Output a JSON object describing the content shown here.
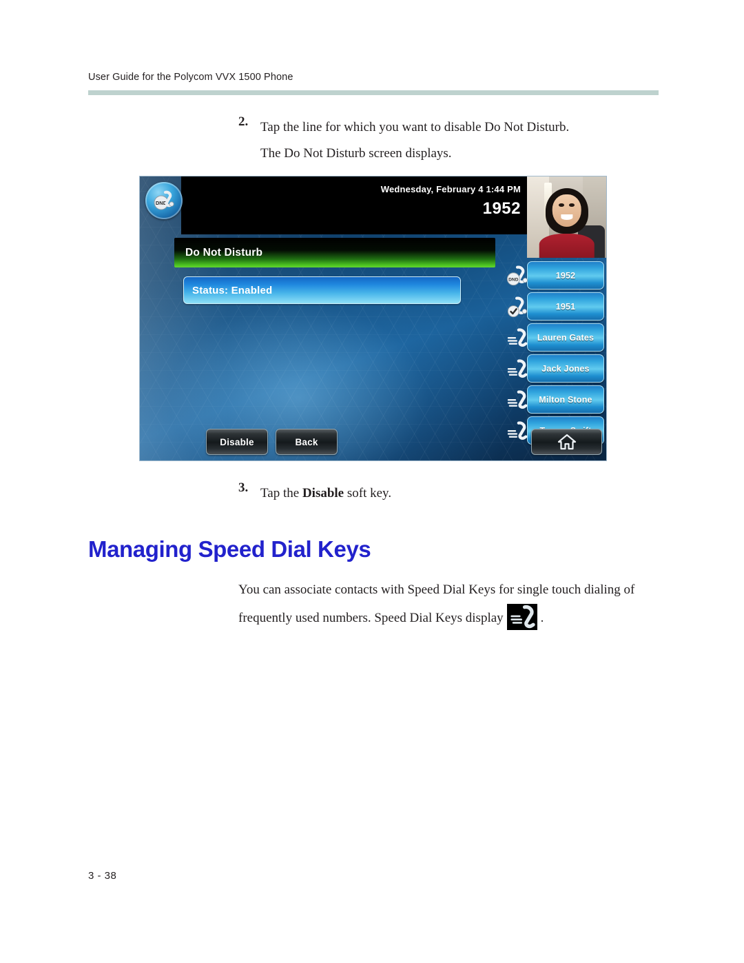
{
  "header": {
    "guide_title": "User Guide for the Polycom VVX 1500 Phone"
  },
  "steps": [
    {
      "number": "2.",
      "text": "Tap the line for which you want to disable Do Not Disturb.",
      "subtext": "The Do Not Disturb screen displays."
    },
    {
      "number": "3.",
      "text_before": "Tap the ",
      "text_bold": "Disable",
      "text_after": " soft key."
    }
  ],
  "phone_screen": {
    "dnd_badge_icon": "dnd-badge-icon",
    "status_bar": {
      "datetime": "Wednesday, February 4  1:44 PM",
      "extension": "1952"
    },
    "video_thumbnail": "video-self-view",
    "title": "Do Not Disturb",
    "status_item": "Status: Enabled",
    "line_keys": [
      {
        "label": "1952",
        "icon": "dnd-line-icon"
      },
      {
        "label": "1951",
        "icon": "registered-line-icon"
      },
      {
        "label": "Lauren Gates",
        "icon": "speed-dial-icon"
      },
      {
        "label": "Jack Jones",
        "icon": "speed-dial-icon"
      },
      {
        "label": "Milton Stone",
        "icon": "speed-dial-icon"
      },
      {
        "label": "Teresa Swift",
        "icon": "speed-dial-icon"
      }
    ],
    "soft_keys": [
      {
        "label": "Disable"
      },
      {
        "label": "Back"
      }
    ],
    "home_key_icon": "home-icon"
  },
  "section": {
    "heading": "Managing Speed Dial Keys",
    "heading_color": "#2222cc",
    "paragraph_before": "You can associate contacts with Speed Dial Keys for single touch dialing of frequently used numbers. Speed Dial Keys display",
    "paragraph_icon": "speed-dial-icon",
    "paragraph_after": "."
  },
  "footer": {
    "page_number": "3 - 38"
  },
  "colors": {
    "rule": "#bed2ce",
    "heading": "#2222cc",
    "text": "#231f20"
  }
}
